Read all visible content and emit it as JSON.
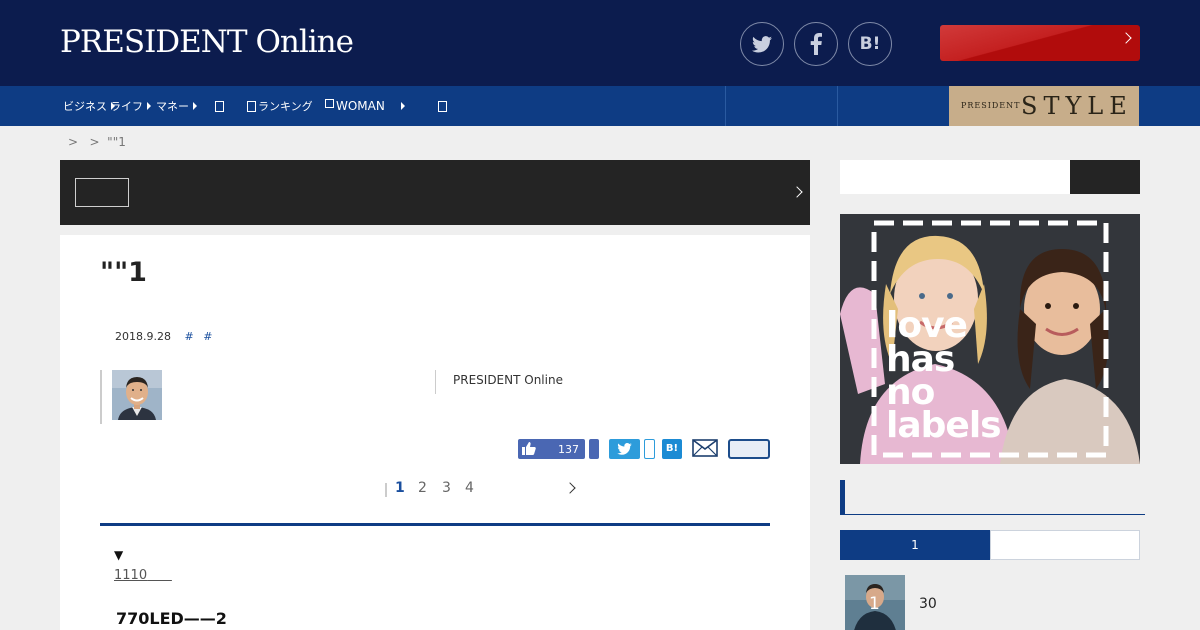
{
  "header": {
    "logo": "PRESIDENT Online",
    "social": [
      {
        "icon": "twitter-icon"
      },
      {
        "icon": "facebook-icon"
      },
      {
        "icon": "hatena-bookmark-icon",
        "label": "B!"
      }
    ],
    "cta_icon": "chevron-right-icon"
  },
  "nav": {
    "items": [
      {
        "label": "ビジネス"
      },
      {
        "label": "ライフ"
      },
      {
        "label": "マネー"
      },
      {
        "label": ""
      },
      {
        "label": "ランキング"
      },
      {
        "label": "WOMAN"
      },
      {
        "label": ""
      }
    ],
    "style_banner": {
      "prefix": "PRESIDENT",
      "word": "STYLE"
    }
  },
  "breadcrumb": ">   >  \"\"1",
  "article": {
    "title": "\"\"1",
    "date": "2018.9.28",
    "tags": [
      "#",
      "#"
    ],
    "author_source": "PRESIDENT Online",
    "like_count": "137",
    "hatena_label": "B!",
    "pages": [
      "1",
      "2",
      "3",
      "4"
    ],
    "current_page": "1",
    "toc_arrow": "▼",
    "toc_link": "1110",
    "subhead": "770LED——2"
  },
  "ad": {
    "lines": [
      "love",
      "has",
      "no",
      "labels"
    ]
  },
  "ranking": {
    "tabs": [
      {
        "label": "1"
      },
      {
        "label": ""
      }
    ],
    "items": [
      {
        "rank": "1",
        "title": "30"
      }
    ]
  },
  "colors": {
    "header_bg": "#0c1c4e",
    "nav_bg": "#0e3c84",
    "cta_red": "#b10c0c",
    "accent_blue": "#1a4f9e",
    "style_beige": "#c7ad8a"
  }
}
